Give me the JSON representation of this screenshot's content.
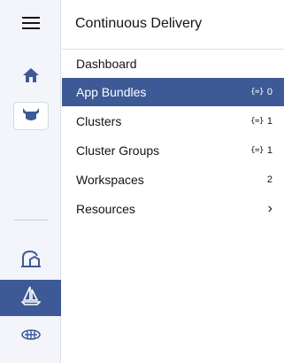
{
  "rail": {
    "icons": [
      "hamburger-icon",
      "home-icon",
      "fleet-icon",
      "harvester-icon",
      "continuous-delivery-icon",
      "fleet-alt-icon"
    ]
  },
  "panel": {
    "title": "Continuous Delivery",
    "items": [
      {
        "label": "Dashboard",
        "count": ""
      },
      {
        "label": "App Bundles",
        "count": "0"
      },
      {
        "label": "Clusters",
        "count": "1"
      },
      {
        "label": "Cluster Groups",
        "count": "1"
      },
      {
        "label": "Workspaces",
        "count": "2"
      },
      {
        "label": "Resources",
        "count": ""
      }
    ],
    "resource_glyph": "{=}",
    "chevron": "›"
  },
  "colors": {
    "accent": "#3d5a96",
    "rail_bg": "#f4f5fa",
    "text": "#141419"
  }
}
